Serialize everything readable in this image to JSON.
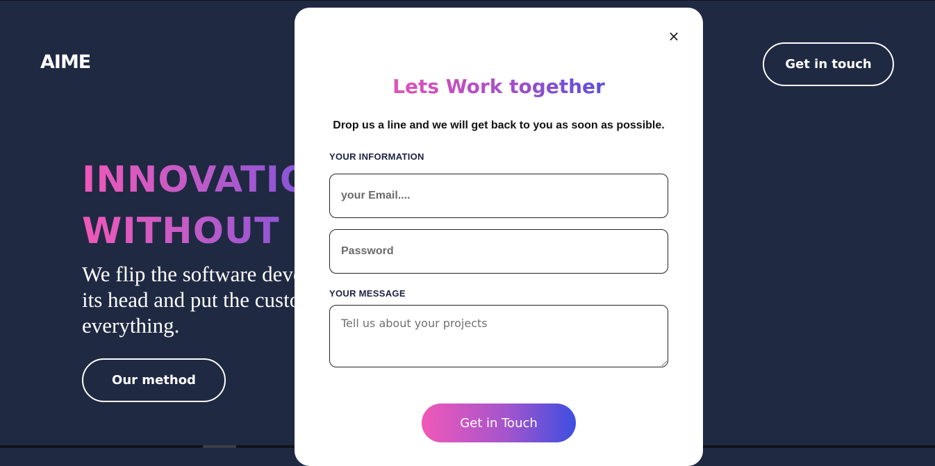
{
  "header": {
    "logo": "AIME",
    "cta_label": "Get in touch"
  },
  "hero": {
    "title_line1": "INNOVATION",
    "title_line2": "WITHOUT LIMITS",
    "description": "We flip the software development process on its head and put the customer at the center of everything.",
    "button_label": "Our method"
  },
  "modal": {
    "close_label": "×",
    "title": "Lets Work together",
    "subtitle": "Drop us a line and we will get back to you as soon as possible.",
    "info_label": "YOUR INFORMATION",
    "email_placeholder": "your Email....",
    "password_placeholder": "Password",
    "message_label": "YOUR MESSAGE",
    "message_placeholder": "Tell us about your projects",
    "submit_label": "Get in Touch"
  },
  "colors": {
    "background": "#1f2942",
    "gradient_pink": "#f058b8",
    "gradient_blue": "#3d4fe0",
    "modal_background": "#ffffff"
  }
}
